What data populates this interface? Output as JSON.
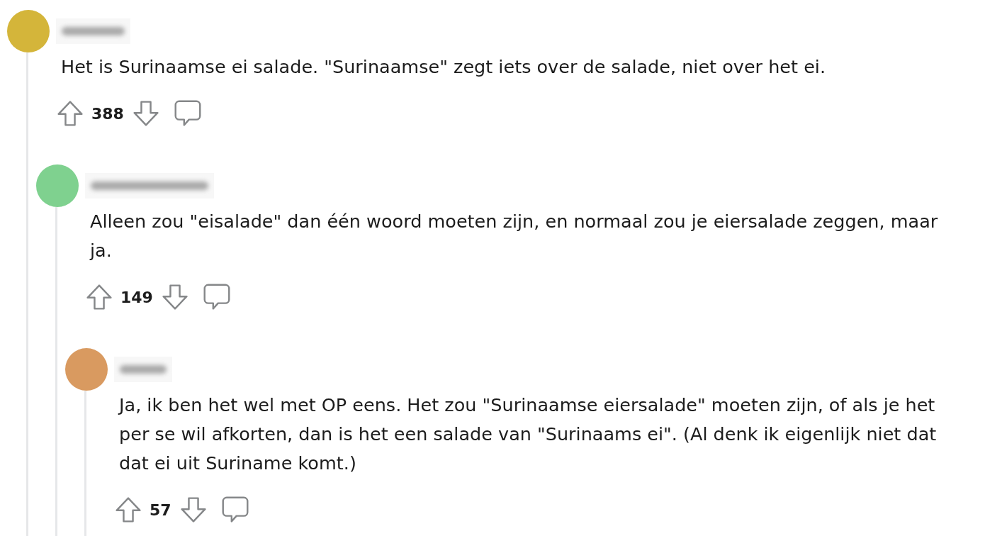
{
  "comments": [
    {
      "color": "#d4b53a",
      "body": "Het is Surinaamse ei salade. \"Surinaamse\" zegt iets over de salade, niet over het ei.",
      "score": "388",
      "children": [
        {
          "color": "#7fd18f",
          "body": "Alleen zou \"eisalade\" dan één woord moeten zijn, en normaal zou je eiersalade zeggen, maar ja.",
          "score": "149",
          "children": [
            {
              "color": "#d99a60",
              "body": "Ja, ik ben het wel met OP eens. Het zou \"Surinaamse eiersalade\" moeten zijn, of als je het per se wil afkorten, dan is het een salade van \"Surinaams ei\". (Al denk ik eigenlijk niet dat dat ei uit Suriname komt.)",
              "score": "57"
            }
          ]
        }
      ]
    }
  ]
}
